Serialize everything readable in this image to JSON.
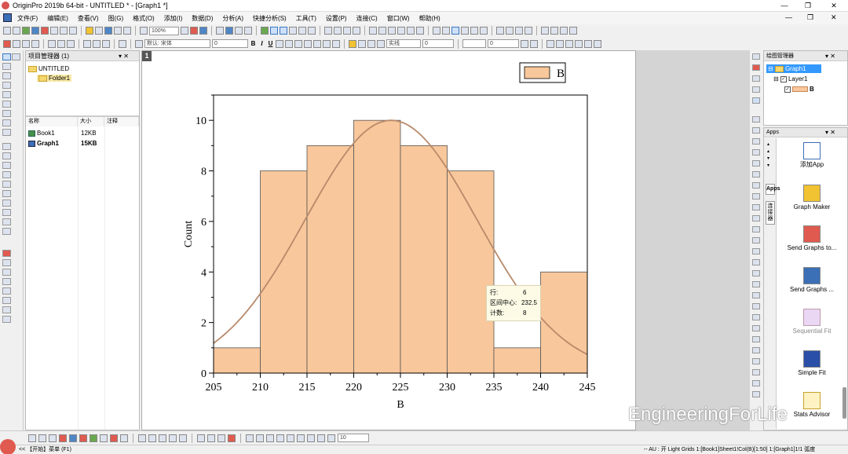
{
  "window": {
    "title": "OriginPro 2019b 64-bit - UNTITLED * - [Graph1 *]",
    "min_glyph": "—",
    "max_glyph": "❐",
    "close_glyph": "✕"
  },
  "menu": {
    "items": [
      "文件(F)",
      "编辑(E)",
      "查看(V)",
      "图(G)",
      "格式(O)",
      "添加(I)",
      "数据(D)",
      "分析(A)",
      "快捷分析(S)",
      "工具(T)",
      "设置(P)",
      "连接(C)",
      "窗口(W)",
      "帮助(H)"
    ],
    "right_controls": [
      "—",
      "❐",
      "✕"
    ]
  },
  "toolbar": {
    "zoom": "100%",
    "font_name": "默认: 宋体",
    "font_size": "0",
    "bold": "B",
    "italic": "I",
    "underline": "U",
    "line_style": "实线",
    "line_width": "0",
    "bottom_combo": "10"
  },
  "project_manager": {
    "title": "项目管理器 (1)",
    "root": "UNTITLED",
    "folder": "Folder1",
    "columns": [
      "名称",
      "大小",
      "注释"
    ],
    "rows": [
      {
        "name": "Book1",
        "size": "12KB",
        "note": ""
      },
      {
        "name": "Graph1",
        "size": "15KB",
        "note": ""
      }
    ]
  },
  "graph": {
    "layer_label": "1",
    "legend_label": "B",
    "colors": {
      "bar_fill": "#f8c79b",
      "bar_edge": "#555555",
      "curve": "#b88a6b"
    }
  },
  "chart_data": {
    "type": "bar",
    "xlabel": "B",
    "ylabel": "Count",
    "bins": [
      [
        205,
        210
      ],
      [
        210,
        215
      ],
      [
        215,
        220
      ],
      [
        220,
        225
      ],
      [
        225,
        230
      ],
      [
        230,
        235
      ],
      [
        235,
        240
      ],
      [
        240,
        245
      ]
    ],
    "values": [
      1,
      8,
      9,
      10,
      9,
      8,
      1,
      4
    ],
    "xlim": [
      205,
      245
    ],
    "ylim": [
      0,
      11
    ],
    "xticks": [
      "205",
      "210",
      "215",
      "220",
      "225",
      "230",
      "235",
      "240",
      "245"
    ],
    "yticks": [
      "0",
      "2",
      "4",
      "6",
      "8",
      "10"
    ],
    "legend": [
      "B"
    ],
    "legend_position": "top-right",
    "fit_curve": {
      "type": "normal",
      "mean": 224,
      "peak": 10,
      "sd": 9.2
    }
  },
  "tooltip": {
    "rows": [
      {
        "key": "行:",
        "value": "6"
      },
      {
        "key": "区间中心:",
        "value": "232.5"
      },
      {
        "key": "计数:",
        "value": "8"
      }
    ]
  },
  "object_manager": {
    "title": "绘图管理器",
    "graph": "Graph1",
    "layer": "Layer1",
    "plot": "B"
  },
  "apps": {
    "title": "Apps",
    "tabs": [
      "Apps",
      "连接器"
    ],
    "items": [
      {
        "label": "添加App",
        "enabled": true
      },
      {
        "label": "Graph Maker",
        "enabled": true
      },
      {
        "label": "Send Graphs to...",
        "enabled": true
      },
      {
        "label": "Send Graphs ...",
        "enabled": true
      },
      {
        "label": "Sequential Fit",
        "enabled": false
      },
      {
        "label": "Simple Fit",
        "enabled": true
      },
      {
        "label": "Stats Advisor",
        "enabled": true
      }
    ]
  },
  "statusbar": {
    "left": "<< 【开始】菜单 (F1)",
    "right": "-- AU : 开 Light Grids 1:[Book1]Sheet1!Col(B)[1:50] 1:[Graph1]1!1 弧度"
  },
  "watermark": "EngineeringForLife"
}
